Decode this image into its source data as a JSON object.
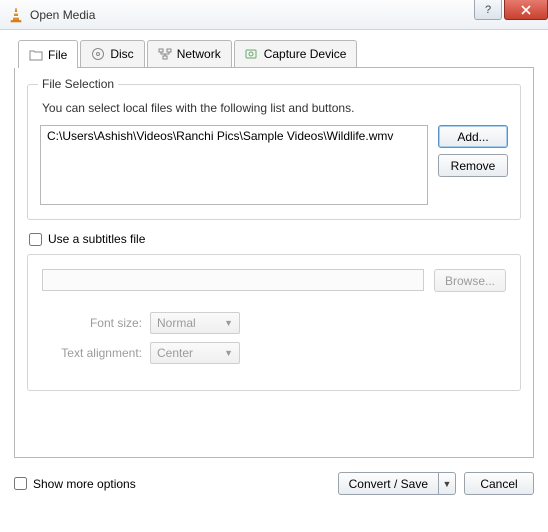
{
  "titlebar": {
    "title": "Open Media"
  },
  "tabs": {
    "file": "File",
    "disc": "Disc",
    "network": "Network",
    "capture": "Capture Device"
  },
  "fileSelection": {
    "legend": "File Selection",
    "instruction": "You can select local files with the following list and buttons.",
    "files": [
      "C:\\Users\\Ashish\\Videos\\Ranchi Pics\\Sample Videos\\Wildlife.wmv"
    ],
    "addLabel": "Add...",
    "removeLabel": "Remove"
  },
  "subtitles": {
    "checkboxLabel": "Use a subtitles file",
    "browseLabel": "Browse...",
    "fontSizeLabel": "Font size:",
    "fontSizeValue": "Normal",
    "alignLabel": "Text alignment:",
    "alignValue": "Center"
  },
  "footer": {
    "showMoreLabel": "Show more options",
    "convertLabel": "Convert / Save",
    "cancelLabel": "Cancel"
  }
}
